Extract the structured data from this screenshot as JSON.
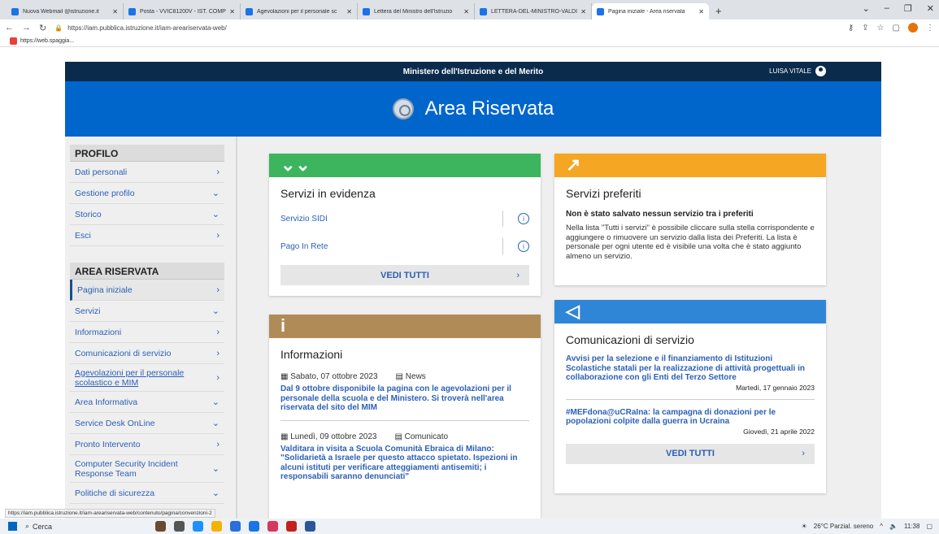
{
  "browser": {
    "tabs": [
      {
        "title": "Nuova Webmail @istruzione.it"
      },
      {
        "title": "Posta - VVIC81200V - IST. COMP"
      },
      {
        "title": "Agevolazioni per il personale sc"
      },
      {
        "title": "Lettera del Ministro dell'Istruzio"
      },
      {
        "title": "LETTERA-DEL-MINISTRO-VALDI"
      },
      {
        "title": "Pagina iniziale - Area riservata"
      }
    ],
    "url": "https://iam.pubblica.istruzione.it/iam-areariservata-web/",
    "bookmark": "https://web.spaggia...",
    "status_url": "https://iam.pubblica.istruzione.it/iam-areariservata-web/contenuto/pagina/convenzioni-2"
  },
  "site": {
    "ministry": "Ministero dell'Istruzione e del Merito",
    "user": "LUISA VITALE",
    "title": "Area Riservata"
  },
  "sidebar": {
    "profilo_title": "PROFILO",
    "profilo": [
      {
        "label": "Dati personali",
        "chevron": "›"
      },
      {
        "label": "Gestione profilo",
        "chevron": "⌄"
      },
      {
        "label": "Storico",
        "chevron": "⌄"
      },
      {
        "label": "Esci",
        "chevron": "›"
      }
    ],
    "area_title": "AREA RISERVATA",
    "area": [
      {
        "label": "Pagina iniziale",
        "chevron": "›"
      },
      {
        "label": "Servizi",
        "chevron": "⌄"
      },
      {
        "label": "Informazioni",
        "chevron": "›"
      },
      {
        "label": "Comunicazioni di servizio",
        "chevron": "›"
      },
      {
        "label": "Agevolazioni per il personale scolastico e MIM",
        "chevron": "›"
      },
      {
        "label": "Area Informativa",
        "chevron": "⌄"
      },
      {
        "label": "Service Desk OnLine",
        "chevron": "⌄"
      },
      {
        "label": "Pronto Intervento",
        "chevron": "›"
      },
      {
        "label": "Computer Security Incident Response Team",
        "chevron": "⌄"
      },
      {
        "label": "Politiche di sicurezza",
        "chevron": "⌄"
      }
    ]
  },
  "evidenza": {
    "title": "Servizi in evidenza",
    "items": [
      "Servizio SIDI",
      "Pago In Rete"
    ],
    "button": "VEDI TUTTI",
    "color": "#3cb55e"
  },
  "preferiti": {
    "title": "Servizi preferiti",
    "empty_title": "Non è stato salvato nessun servizio tra i preferiti",
    "empty_desc": "Nella lista \"Tutti i servizi\" è possibile cliccare sulla stella corrispondente e aggiungere o rimuovere un servizio dalla lista dei Preferiti. La lista è personale per ogni utente ed è visibile una volta che è stato aggiunto almeno un servizio.",
    "color": "#f5a623"
  },
  "informazioni": {
    "title": "Informazioni",
    "icon": "i",
    "color": "#b08b58",
    "items": [
      {
        "date": "Sabato, 07 ottobre 2023",
        "tag": "News",
        "title": "Dal 9 ottobre disponibile la pagina con le agevolazioni per il personale della scuola e del Ministero. Si troverà nell'area riservata del sito del MIM"
      },
      {
        "date": "Lunedì, 09 ottobre 2023",
        "tag": "Comunicato",
        "title": "Valditara in visita a Scuola Comunità Ebraica di Milano: \"Solidarietà a Israele per questo attacco spietato. Ispezioni in alcuni istituti per verificare atteggiamenti antisemiti; i responsabili saranno denunciati\""
      }
    ]
  },
  "comunicazioni": {
    "title": "Comunicazioni di servizio",
    "color": "#2f86d6",
    "items": [
      {
        "title": "Avvisi per la selezione e il finanziamento di Istituzioni Scolastiche statali per la realizzazione di attività progettuali in collaborazione con gli Enti del Terzo Settore",
        "date": "Martedì, 17 gennaio 2023"
      },
      {
        "title": "#MEFdona@uCRaIna: la campagna di donazioni per le popolazioni colpite dalla guerra in Ucraina",
        "date": "Giovedì, 21 aprile 2022"
      }
    ],
    "button": "VEDI TUTTI"
  },
  "taskbar": {
    "search": "Cerca",
    "weather": "26°C  Parzial. sereno",
    "time": "11:38"
  }
}
